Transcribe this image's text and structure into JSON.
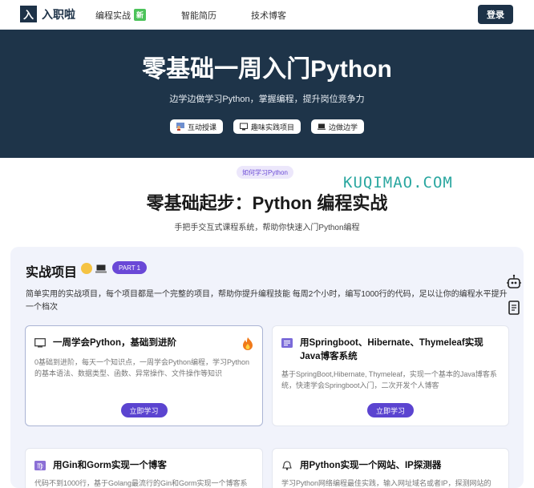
{
  "nav": {
    "logo_mark": "入",
    "logo_text": "入职啦",
    "links": [
      {
        "label": "编程实战",
        "badge": "新"
      },
      {
        "label": "智能简历"
      },
      {
        "label": "技术博客"
      }
    ],
    "login_label": "登录"
  },
  "hero": {
    "title": "零基础一周入门Python",
    "subtitle": "边学边做学习Python，掌握编程，提升岗位竞争力",
    "tags": [
      {
        "icon": "teacher-icon",
        "label": "互动授课"
      },
      {
        "icon": "monitor-icon",
        "label": "趣味实践项目"
      },
      {
        "icon": "laptop-icon",
        "label": "边做边学"
      }
    ]
  },
  "section": {
    "pill": "如何学习Python",
    "title": "零基础起步：Python 编程实战",
    "subtitle": "手把手交互式课程系统，帮助你快速入门Python编程",
    "watermark": "KUQIMAO.COM"
  },
  "panel": {
    "title": "实战项目",
    "badge": "PART 1",
    "description": "简单实用的实战项目，每个项目都是一个完整的项目，帮助你提升编程技能 每周2个小时，编写1000行的代码，足以让你的编程水平提升一个档次",
    "cards": [
      {
        "icon": "book-icon",
        "title": "一周学会Python，基础到进阶",
        "body": "0基础到进阶，每天一个知识点，一周学会Python编程，学习Python的基本语法、数据类型、函数、异常操作、文件操作等知识",
        "button": "立即学习"
      },
      {
        "icon": "document-icon",
        "title": "用Springboot、Hibernate、Thymeleaf实现Java博客系统",
        "body": "基于SpringBoot,Hibernate, Thymeleaf，实现一个基本的Java博客系统，快速学会Springboot入门，二次开发个人博客",
        "button": "立即学习"
      },
      {
        "icon": "virgo-icon",
        "title": "用Gin和Gorm实现一个博客",
        "body": "代码不到1000行，基于Golang最流行的Gin和Gorm实现一个博客系"
      },
      {
        "icon": "bell-icon",
        "title": "用Python实现一个网站、IP探测器",
        "body": "学习Python网络编程最佳实践，输入网址域名或者IP，探测网站的"
      }
    ]
  },
  "colors": {
    "navy": "#1e3449",
    "accent_purple": "#5b44d0",
    "badge_green": "#4cc35a",
    "panel_bg": "#f1f3fb"
  }
}
